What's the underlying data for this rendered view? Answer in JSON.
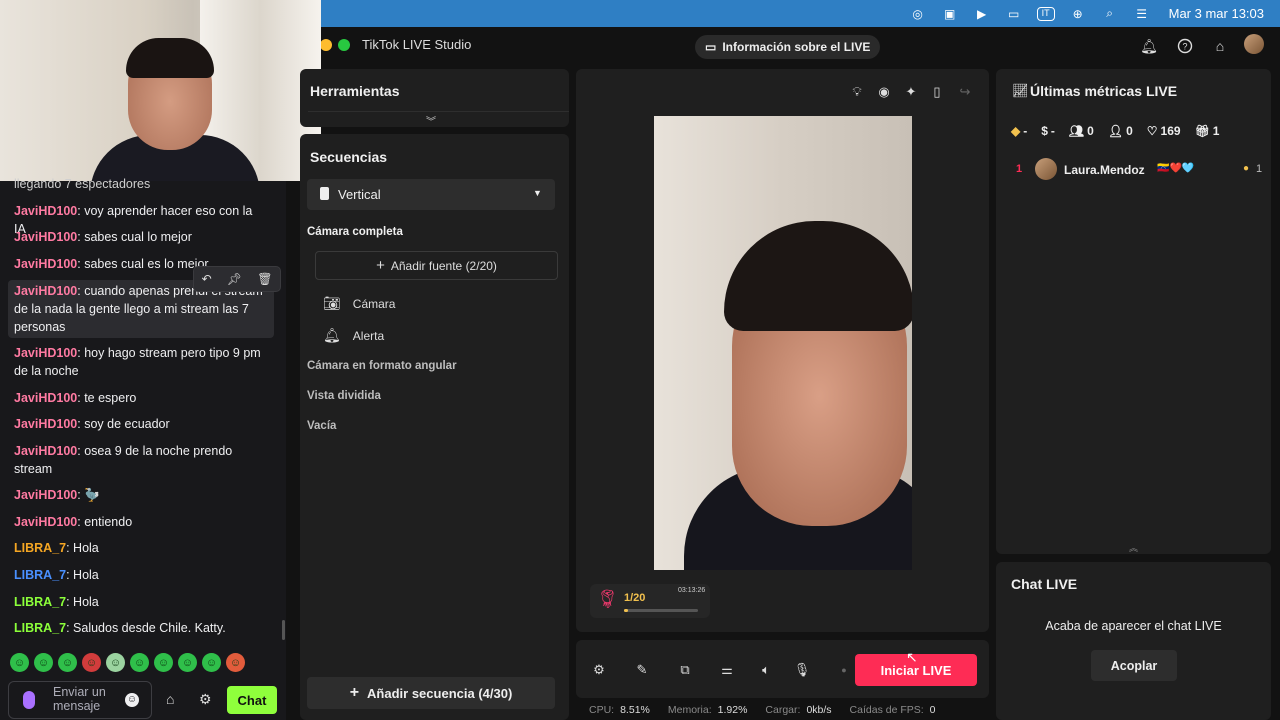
{
  "menubar": {
    "icons": [
      "creative-cloud-icon",
      "screen-record-icon",
      "play-icon",
      "battery-icon",
      "input-source-icon",
      "link-icon",
      "search-icon",
      "control-center-icon"
    ],
    "input_source": "IT",
    "datetime": "Mar 3 mar 13:03"
  },
  "window": {
    "title": "TikTok LIVE Studio",
    "live_info_label": "Información sobre el LIVE"
  },
  "chat": {
    "messages": [
      {
        "user": "",
        "text": "llegando 7 espectadores",
        "color": "#efeff1"
      },
      {
        "user": "JaviHD100",
        "text": ": voy aprender hacer eso con la IA",
        "color": "#ff7aa2"
      },
      {
        "user": "JaviHD100",
        "text": ": sabes cual lo mejor",
        "color": "#ff7aa2"
      },
      {
        "user": "JaviHD100",
        "text": ": sabes cual es lo mejor",
        "color": "#ff7aa2"
      },
      {
        "user": "JaviHD100",
        "text": ": cuando apenas prendi el stream de la nada la gente llego a mi stream las 7 personas",
        "color": "#ff7aa2"
      },
      {
        "user": "JaviHD100",
        "text": ": hoy hago stream pero tipo 9 pm de la noche",
        "color": "#ff7aa2"
      },
      {
        "user": "JaviHD100",
        "text": ": te espero",
        "color": "#ff7aa2"
      },
      {
        "user": "JaviHD100",
        "text": ": soy de ecuador",
        "color": "#ff7aa2"
      },
      {
        "user": "JaviHD100",
        "text": ": osea 9 de la noche prendo stream",
        "color": "#ff7aa2"
      },
      {
        "user": "JaviHD100",
        "text": ": 🦤",
        "color": "#ff7aa2"
      },
      {
        "user": "JaviHD100",
        "text": ": entiendo",
        "color": "#ff7aa2"
      },
      {
        "user": "LIBRA_7",
        "text": ": Hola",
        "color": "#f5a623"
      },
      {
        "user": "LIBRA_7",
        "text": ": Hola",
        "color": "#4a90ff"
      },
      {
        "user": "LIBRA_7",
        "text": ": Hola",
        "color": "#8cff3a"
      },
      {
        "user": "LIBRA_7",
        "text": ": Saludos desde Chile. Katty.",
        "color": "#8cff3a"
      }
    ],
    "input_placeholder": "Enviar un mensaje",
    "send_label": "Chat"
  },
  "tools": {
    "title": "Herramientas"
  },
  "sequences": {
    "title": "Secuencias",
    "layout_selected": "Vertical",
    "group_title": "Cámara completa",
    "add_source_label": "Añadir fuente (2/20)",
    "sources": [
      "Cámara",
      "Alerta"
    ],
    "other_sequences": [
      "Cámara en formato angular",
      "Vista dividida",
      "Vacía"
    ],
    "add_sequence_label": "Añadir secuencia (4/30)"
  },
  "preview": {
    "gift_progress_text": "1/20",
    "gift_progress_fraction": 0.05,
    "gift_timer": "03:13:26"
  },
  "controls": {
    "go_live_label": "Iniciar LIVE",
    "stats": [
      {
        "label": "CPU:",
        "value": "8.51%"
      },
      {
        "label": "Memoria:",
        "value": "1.92%"
      },
      {
        "label": "Cargar:",
        "value": "0kb/s"
      },
      {
        "label": "Caídas de FPS:",
        "value": "0"
      }
    ]
  },
  "metrics": {
    "title": "Últimas métricas LIVE",
    "values": [
      {
        "icon": "diamond-icon",
        "value": "-"
      },
      {
        "icon": "coin-icon",
        "value": "-"
      },
      {
        "icon": "viewers-icon",
        "value": "0"
      },
      {
        "icon": "new-followers-icon",
        "value": "0"
      },
      {
        "icon": "heart-icon",
        "value": "169"
      },
      {
        "icon": "gift-icon",
        "value": "1"
      }
    ],
    "ranking": [
      {
        "rank": "1",
        "name": "Laura.Mendoz",
        "flair": "🇻🇪❤️🩵",
        "score": "1"
      }
    ]
  },
  "chat_live": {
    "title": "Chat LIVE",
    "message": "Acaba de aparecer el chat LIVE",
    "dock_label": "Acoplar"
  }
}
